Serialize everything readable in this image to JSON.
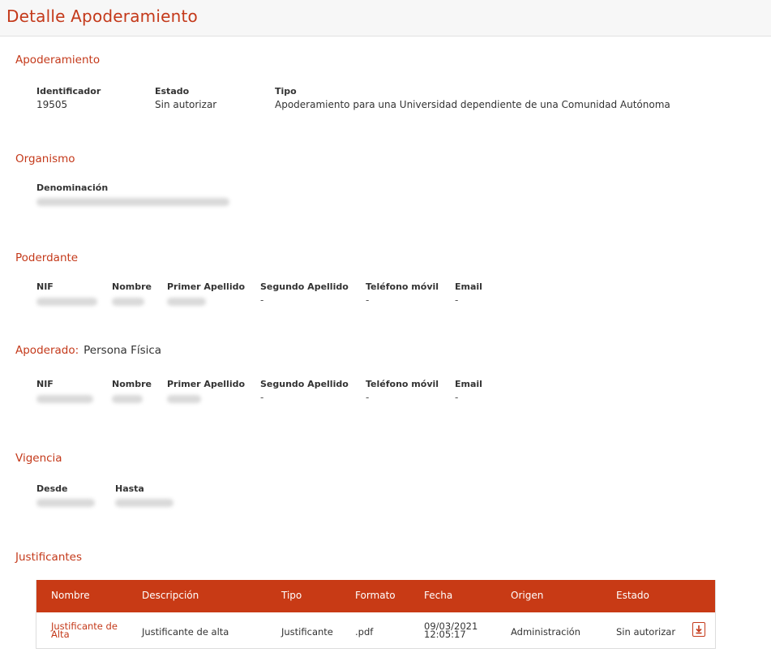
{
  "page_title": "Detalle Apoderamiento",
  "apoderamiento": {
    "title": "Apoderamiento",
    "identificador_label": "Identificador",
    "identificador": "19505",
    "estado_label": "Estado",
    "estado": "Sin autorizar",
    "tipo_label": "Tipo",
    "tipo": "Apoderamiento para una Universidad dependiente de una Comunidad Autónoma"
  },
  "organismo": {
    "title": "Organismo",
    "denominacion_label": "Denominación"
  },
  "poderdante": {
    "title": "Poderdante",
    "labels": [
      "NIF",
      "Nombre",
      "Primer Apellido",
      "Segundo Apellido",
      "Teléfono móvil",
      "Email"
    ],
    "segundo_apellido": "-",
    "telefono": "-",
    "email": "-"
  },
  "apoderado": {
    "title": "Apoderado:",
    "tipo": "Persona Física",
    "labels": [
      "NIF",
      "Nombre",
      "Primer Apellido",
      "Segundo Apellido",
      "Teléfono móvil",
      "Email"
    ],
    "segundo_apellido": "-",
    "telefono": "-",
    "email": "-"
  },
  "vigencia": {
    "title": "Vigencia",
    "desde_label": "Desde",
    "hasta_label": "Hasta"
  },
  "justificantes": {
    "title": "Justificantes",
    "columns": [
      "Nombre",
      "Descripción",
      "Tipo",
      "Formato",
      "Fecha",
      "Origen",
      "Estado"
    ],
    "rows": [
      {
        "nombre": "Justificante de Alta",
        "descripcion": "Justificante de alta",
        "tipo": "Justificante",
        "formato": ".pdf",
        "fecha": "09/03/2021 12:05:17",
        "origen": "Administración",
        "estado": "Sin autorizar",
        "action_icon": "download-icon"
      }
    ]
  },
  "colors": {
    "accent": "#c4391a",
    "table_header": "#c83a15"
  }
}
